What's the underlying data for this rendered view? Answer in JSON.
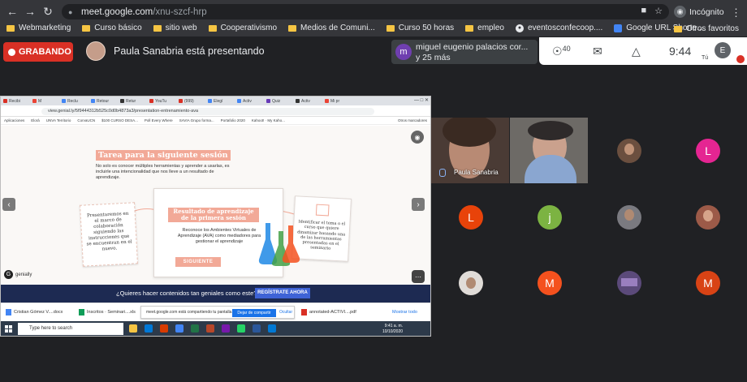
{
  "browser": {
    "url_host": "meet.google.com",
    "url_path": "/xnu-szcf-hrp",
    "incognito_label": "Incógnito",
    "bookmarks": [
      {
        "label": "Webmarketing",
        "icon": "folder-icon"
      },
      {
        "label": "Curso básico",
        "icon": "folder-icon"
      },
      {
        "label": "sitio web",
        "icon": "folder-icon"
      },
      {
        "label": "Cooperativismo",
        "icon": "folder-icon"
      },
      {
        "label": "Medios de Comuni...",
        "icon": "folder-icon"
      },
      {
        "label": "Curso 50 horas",
        "icon": "folder-icon"
      },
      {
        "label": "empleo",
        "icon": "folder-icon"
      },
      {
        "label": "eventosconfecoop....",
        "icon": "globe-icon"
      },
      {
        "label": "Google URL Shorte...",
        "icon": "google-icon"
      }
    ],
    "other_bookmarks": "Otros favoritos"
  },
  "meet": {
    "recording_label": "GRABANDO",
    "presenting_text": "Paula Sanabria está presentando",
    "chip_avatar_letter": "m",
    "chip_name": "miguel eugenio palacios cor...",
    "chip_more": "y 25 más",
    "participants_count": "40",
    "clock": "9:44",
    "self_letter": "E",
    "self_label": "Tú",
    "colors": {
      "recording": "#d93025",
      "background": "#202124"
    }
  },
  "presentation": {
    "inner_tabs": [
      "Recibi",
      "M",
      "Reclu",
      "Retour",
      "Retur",
      "YouTu",
      "(999)",
      "Elegí",
      "Activ",
      "Quiz",
      "Activ",
      "Mi pr"
    ],
    "inner_url": "view.genial.ly/5f9444312b525c0d0b4873a3/presentation-entrenamiento-ava",
    "inner_bookmarks": [
      "Aplicaciones",
      "Elorá",
      "UNVA Territorio",
      "CorvaUCN",
      "$100 CURSO DESA...",
      "Poll Every Where",
      "SAVIA Grupo forma...",
      "Portafolio 2020",
      "Kahoot! · My Kaho...",
      "Otros marcadores"
    ],
    "slide": {
      "title": "Tarea para la siguiente sesión",
      "text": "No solo es conocer múltiples herramientas y aprender a usarlas, es incluirle una intencionalidad que nos lleve a un resultado de aprendizaje.",
      "card1": "Presentaremos en el marco de colaboración siguiendo las instrucciones que se encuentran en el nuevo.",
      "card2_title": "Resultado de aprendizaje de la primera sesión",
      "card2_text": "Reconoce los Ambientes Virtuales de Aprendizaje (AVA) como mediadores para gestionar el aprendizaje",
      "next_button": "SIGUIENTE",
      "card3": "Identificar el tema o el curso que quiere dinamizar basando una de las herramientas presentadas en el seminario",
      "brand": "genially"
    },
    "cta_text": "¿Quieres hacer contenidos tan geniales como este?",
    "cta_button": "REGÍSTRATE AHORA",
    "downloads": [
      {
        "label": "Cristian Gómez V....docx"
      },
      {
        "label": "Inscritos · Seminari....xls"
      },
      {
        "label": "annotated-ACTIVI....pdf"
      }
    ],
    "share_text": "meet.google.com está compartiendo tu pantalla.",
    "share_stop": "Dejar de compartir",
    "share_hide": "Ocultar",
    "show_all": "Mostrar todo",
    "taskbar_search": "Type here to search",
    "taskbar_time": "9:41 a. m.",
    "taskbar_date": "10/10/2020"
  },
  "tiles": [
    {
      "type": "video",
      "name": "Paula Sanabria"
    },
    {
      "type": "video",
      "name": ""
    },
    {
      "type": "photo"
    },
    {
      "type": "letter",
      "letter": "L",
      "color": "#e52592"
    },
    {
      "type": "letter",
      "letter": "L",
      "color": "#e8430a"
    },
    {
      "type": "letter",
      "letter": "j",
      "color": "#7cb342"
    },
    {
      "type": "photo"
    },
    {
      "type": "photo"
    },
    {
      "type": "photo"
    },
    {
      "type": "letter",
      "letter": "M",
      "color": "#f4511e"
    },
    {
      "type": "photo"
    },
    {
      "type": "letter",
      "letter": "M",
      "color": "#d84315"
    }
  ]
}
